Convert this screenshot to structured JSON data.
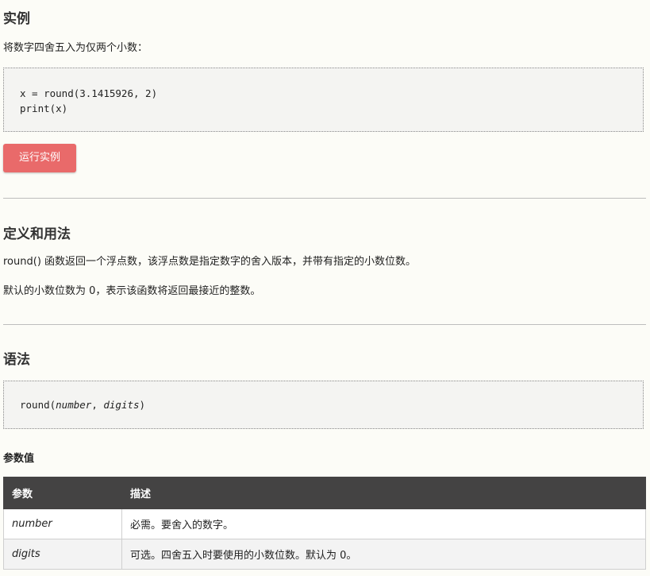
{
  "example": {
    "heading": "实例",
    "description": "将数字四舍五入为仅两个小数：",
    "code": {
      "line1": "x = round(3.1415926, 2)",
      "line2": "print(x)"
    },
    "run_button": "运行实例"
  },
  "definition": {
    "heading": "定义和用法",
    "para1": "round() 函数返回一个浮点数，该浮点数是指定数字的舍入版本，并带有指定的小数位数。",
    "para2": "默认的小数位数为 0，表示该函数将返回最接近的整数。"
  },
  "syntax": {
    "heading": "语法",
    "code_prefix": "round(",
    "param1": "number",
    "sep": ", ",
    "param2": "digits",
    "code_suffix": ")"
  },
  "parameters": {
    "heading": "参数值",
    "columns": [
      "参数",
      "描述"
    ],
    "rows": [
      {
        "name": "number",
        "desc": "必需。要舍入的数字。"
      },
      {
        "name": "digits",
        "desc": "可选。四舍五入时要使用的小数位数。默认为 0。"
      }
    ]
  }
}
